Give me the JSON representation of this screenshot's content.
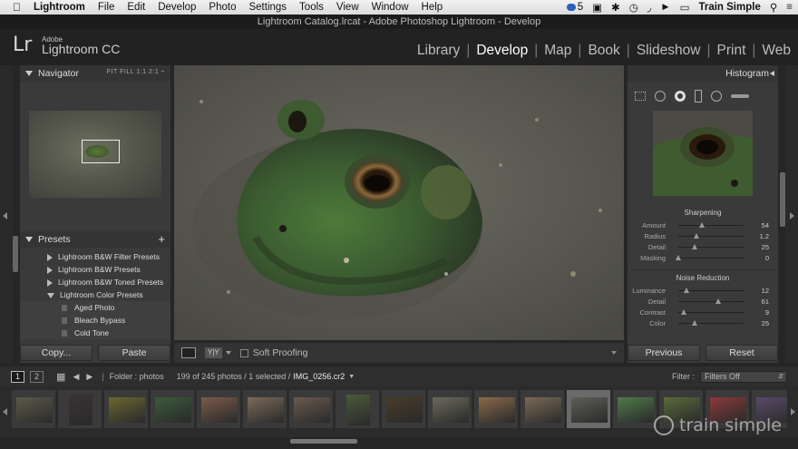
{
  "menubar": {
    "app": "Lightroom",
    "items": [
      "File",
      "Edit",
      "Develop",
      "Photo",
      "Settings",
      "Tools",
      "View",
      "Window",
      "Help"
    ],
    "badge": "5",
    "battery": "100%",
    "user": "Train Simple"
  },
  "window_title": "Lightroom Catalog.lrcat - Adobe Photoshop Lightroom - Develop",
  "identity": {
    "logo": "Lr",
    "adobe": "Adobe",
    "name": "Lightroom CC"
  },
  "modules": [
    "Library",
    "Develop",
    "Map",
    "Book",
    "Slideshow",
    "Print",
    "Web"
  ],
  "active_module": "Develop",
  "navigator": {
    "title": "Navigator",
    "options": "FIT   FILL   1:1   2:1 ÷"
  },
  "presets": {
    "title": "Presets",
    "add": "+",
    "items": [
      {
        "label": "Lightroom B&W Filter Presets",
        "type": "folder"
      },
      {
        "label": "Lightroom B&W Presets",
        "type": "folder"
      },
      {
        "label": "Lightroom B&W Toned Presets",
        "type": "folder"
      },
      {
        "label": "Lightroom Color Presets",
        "type": "open"
      },
      {
        "label": "Aged Photo",
        "type": "item"
      },
      {
        "label": "Bleach Bypass",
        "type": "item"
      },
      {
        "label": "Cold Tone",
        "type": "item"
      }
    ]
  },
  "left_buttons": {
    "copy": "Copy...",
    "paste": "Paste"
  },
  "toolbar": {
    "soft_proofing": "Soft Proofing",
    "yy": "Y|Y"
  },
  "histogram": {
    "title": "Histogram"
  },
  "sharpening": {
    "title": "Sharpening",
    "rows": [
      {
        "label": "Amount",
        "value": "54",
        "pos": 0.36
      },
      {
        "label": "Radius",
        "value": "1.2",
        "pos": 0.28
      },
      {
        "label": "Detail",
        "value": "25",
        "pos": 0.25
      },
      {
        "label": "Masking",
        "value": "0",
        "pos": 0.0
      }
    ]
  },
  "noise": {
    "title": "Noise Reduction",
    "rows": [
      {
        "label": "Luminance",
        "value": "12",
        "pos": 0.12
      },
      {
        "label": "Detail",
        "value": "61",
        "pos": 0.61
      },
      {
        "label": "Contrast",
        "value": "9",
        "pos": 0.09
      },
      {
        "label": "Color",
        "value": "25",
        "pos": 0.25
      }
    ]
  },
  "right_buttons": {
    "previous": "Previous",
    "reset": "Reset"
  },
  "filmhead": {
    "view1": "1",
    "view2": "2",
    "folder": "Folder : photos",
    "count": "199 of 245 photos / 1 selected /",
    "file": "IMG_0256.cr2",
    "filter_label": "Filter :",
    "filter_value": "Filters Off"
  },
  "film_colors": [
    "#5c5a4a",
    "#3a3433",
    "#6a6630",
    "#3c5a3a",
    "#7c5a4a",
    "#7a6a5a",
    "#6a5a4e",
    "#4a5a3a",
    "#4a3a2a",
    "#6a6a5a",
    "#8a6a4a",
    "#7a6a56",
    "#5e5e58",
    "#4f7a4a",
    "#5a6a3a",
    "#8a3a3a",
    "#5a4a6a"
  ],
  "watermark": "train simple"
}
